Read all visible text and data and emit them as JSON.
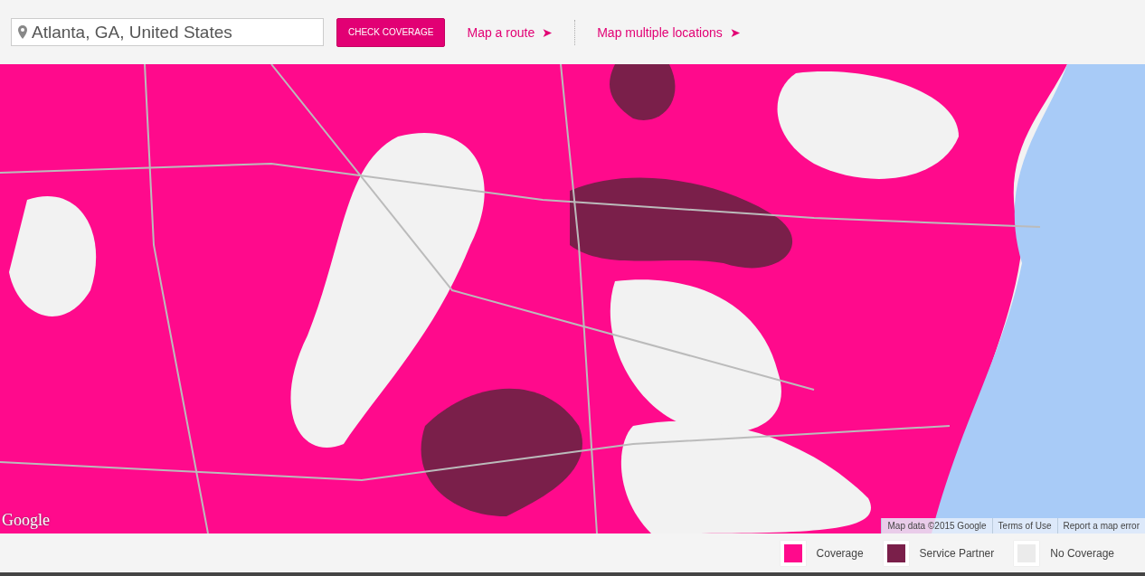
{
  "search": {
    "value": "Atlanta, GA, United States"
  },
  "check_button": "CHECK COVERAGE",
  "links": [
    {
      "label": "Map a route",
      "arrow": "➤"
    },
    {
      "label": "Map multiple locations",
      "arrow": "➤"
    }
  ],
  "map": {
    "logo": "Google",
    "attribution": [
      "Map data ©2015 Google",
      "Terms of Use",
      "Report a map error"
    ]
  },
  "legend": [
    {
      "label": "Coverage",
      "color": "#ff0a8c"
    },
    {
      "label": "Service Partner",
      "color": "#7a1f4a"
    },
    {
      "label": "No Coverage",
      "color": "#ebebeb"
    }
  ]
}
